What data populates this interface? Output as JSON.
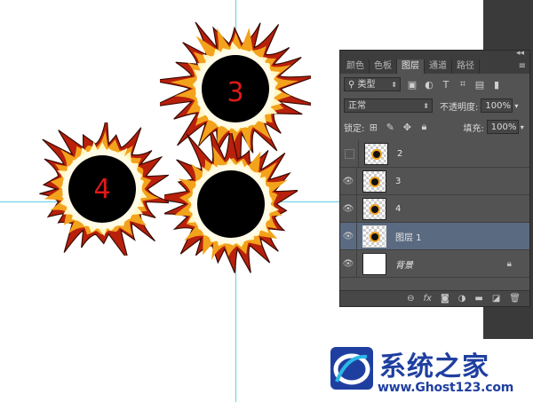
{
  "canvas": {
    "suns": [
      {
        "label": "3"
      },
      {
        "label": "4"
      },
      {
        "label": ""
      }
    ],
    "colors": {
      "guide": "#5fd0e8",
      "label": "#e01818",
      "flame_outer": "#b8200c",
      "flame_mid": "#f3a21b",
      "flame_inner": "#fff7c2",
      "core": "#000000"
    }
  },
  "panel": {
    "tabs": [
      "颜色",
      "色板",
      "图层",
      "通道",
      "路径"
    ],
    "active_tab": "图层",
    "filter": {
      "label": "类型"
    },
    "blend_mode": "正常",
    "opacity_label": "不透明度:",
    "opacity_value": "100%",
    "lock_label": "锁定:",
    "fill_label": "填充:",
    "fill_value": "100%",
    "layers": [
      {
        "name": "2",
        "visible": false
      },
      {
        "name": "3",
        "visible": true
      },
      {
        "name": "4",
        "visible": true
      },
      {
        "name": "图层 1",
        "visible": true,
        "selected": true
      },
      {
        "name": "背景",
        "visible": true,
        "locked": true
      }
    ],
    "bottom_icons": [
      "link-icon",
      "fx-icon",
      "mask-icon",
      "adjustment-icon",
      "folder-icon",
      "new-layer-icon",
      "trash-icon"
    ]
  },
  "watermark": {
    "title": "系统之家",
    "url": "www.Ghost123.com"
  }
}
